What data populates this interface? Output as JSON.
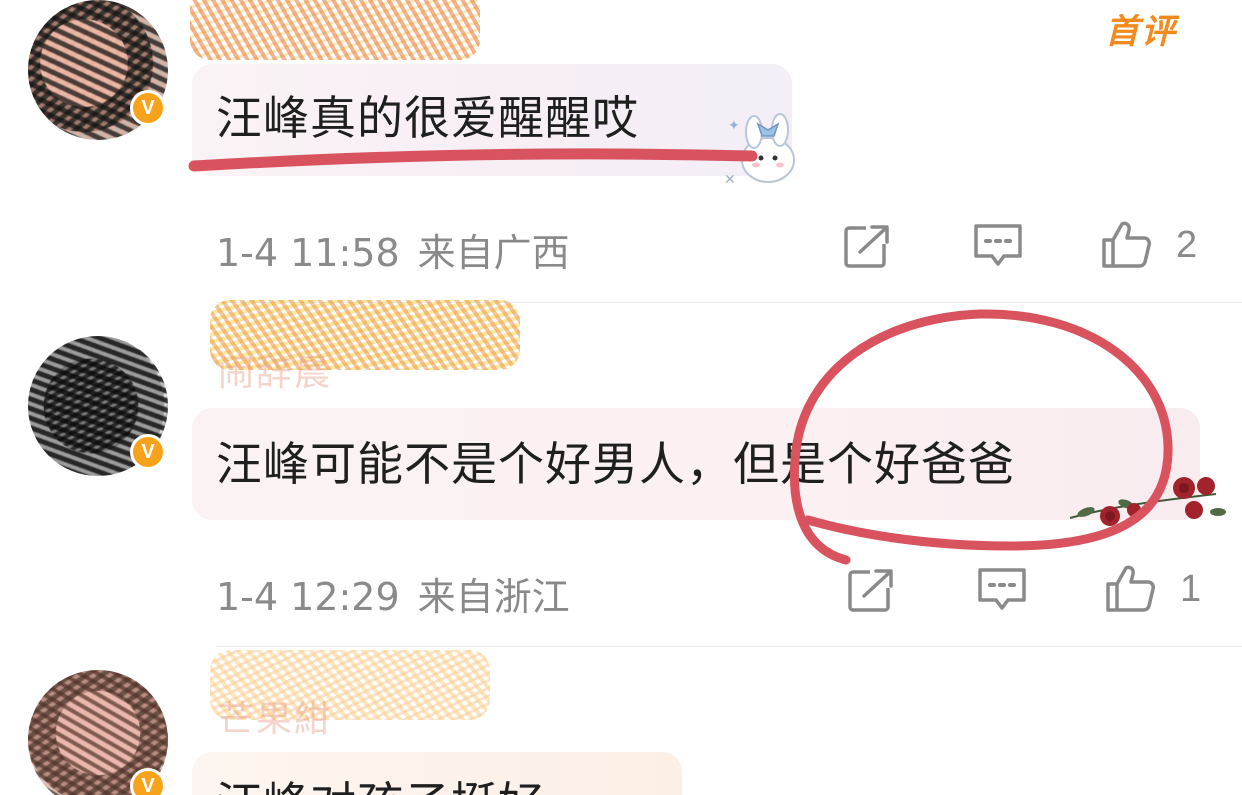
{
  "colors": {
    "accent_orange": "#f28a1d",
    "verified_badge": "#f7a21b",
    "meta_gray": "#8a8a8a",
    "annotation_red": "#d9535f"
  },
  "first_comment_tag": "首评",
  "comments": [
    {
      "text": "汪峰真的很爱醒醒哎",
      "date": "1-4 11:58",
      "location": "来自广西",
      "likes": "2",
      "verified_badge": "V"
    },
    {
      "username": "闹辞晨",
      "text": "汪峰可能不是个好男人，但是个好爸爸",
      "date": "1-4 12:29",
      "location": "来自浙江",
      "likes": "1",
      "verified_badge": "V"
    },
    {
      "username": "芒果紺",
      "text": "汪峰对孩子挺好",
      "verified_badge": "V"
    }
  ],
  "icons": {
    "share": "share-icon",
    "reply": "reply-icon",
    "like": "thumbs-up-icon",
    "verified": "verified-v-icon"
  }
}
